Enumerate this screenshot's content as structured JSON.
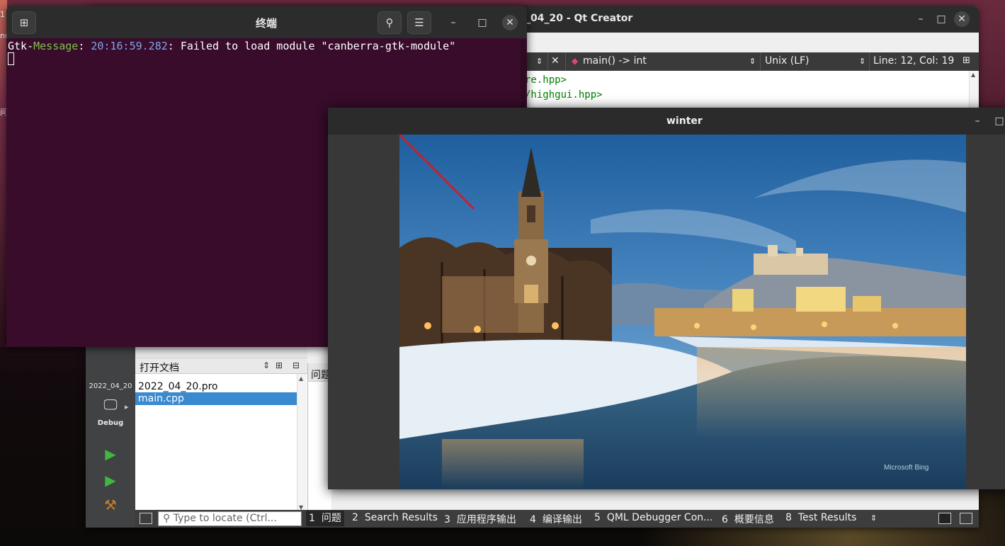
{
  "desktop": {
    "side_chars": [
      "1",
      "nu",
      "问"
    ]
  },
  "qtcreator": {
    "title": "_04_20 - Qt Creator",
    "editor_bar": {
      "function": "main() -> int",
      "line_ending": "Unix (LF)",
      "cursor_pos": "Line: 12, Col: 19"
    },
    "code_lines": [
      "re.hpp>",
      "/highgui.hpp>"
    ],
    "modebar": {
      "project": "2022_04_20",
      "build_config": "Debug"
    },
    "open_documents": {
      "title": "打开文档",
      "items": [
        "2022_04_20.pro",
        "main.cpp"
      ],
      "selected": "main.cpp"
    },
    "issues_label": "问题",
    "statusbar": {
      "locate_placeholder": "Type to locate (Ctrl...",
      "panes": [
        {
          "num": "1",
          "label": "问题"
        },
        {
          "num": "2",
          "label": "Search Results"
        },
        {
          "num": "3",
          "label": "应用程序输出"
        },
        {
          "num": "4",
          "label": "编译输出"
        },
        {
          "num": "5",
          "label": "QML Debugger Con..."
        },
        {
          "num": "6",
          "label": "概要信息"
        },
        {
          "num": "8",
          "label": "Test Results"
        }
      ]
    }
  },
  "terminal": {
    "title": "终端",
    "output": {
      "prefix": "Gtk-",
      "tag": "Message",
      "colon1": ": ",
      "time": "20:16:59.282",
      "message": ": Failed to load module \"canberra-gtk-module\""
    }
  },
  "winter_window": {
    "title": "winter",
    "watermark": "Microsoft Bing"
  },
  "colors": {
    "terminal_bg": "#380c2a",
    "terminal_green": "#7ec14a",
    "terminal_blue": "#7fa7e8",
    "selection_blue": "#3a8ad0",
    "drawn_line": "#e0141c"
  }
}
